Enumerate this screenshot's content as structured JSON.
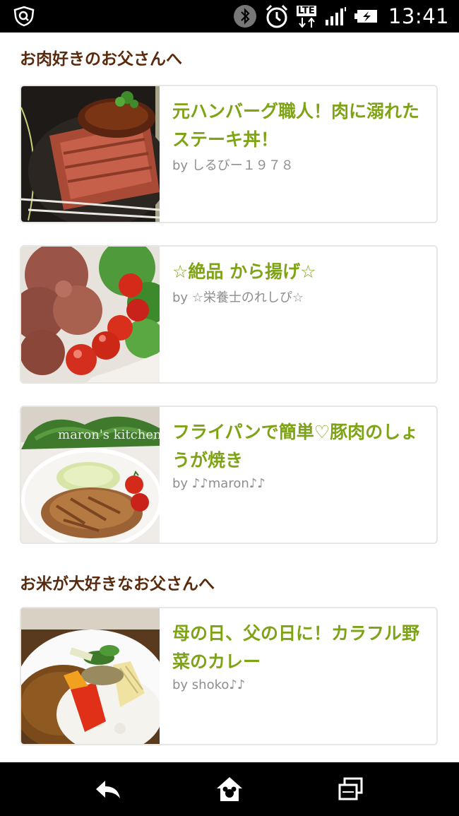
{
  "status_bar": {
    "time": "13:41",
    "network": "LTE",
    "icons": [
      "shield-search-icon",
      "bluetooth-icon",
      "alarm-icon",
      "lte-icon",
      "signal-icon",
      "battery-charging-icon"
    ]
  },
  "sections": [
    {
      "title": "お肉好きのお父さんへ",
      "recipes": [
        {
          "title": "元ハンバーグ職人！肉に溺れたステーキ丼！",
          "author": "by しるびー１９７８"
        },
        {
          "title": "☆絶品 から揚げ☆",
          "author": "by ☆栄養士のれしぴ☆"
        },
        {
          "title": "フライパンで簡単♡豚肉のしょうが焼き",
          "author": "by ♪♪maron♪♪",
          "image_text": "maron's kitchen"
        }
      ]
    },
    {
      "title": "お米が大好きなお父さんへ",
      "recipes": [
        {
          "title": "母の日、父の日に！カラフル野菜のカレー",
          "author": "by shoko♪♪"
        }
      ]
    }
  ],
  "nav_bar": {
    "icons": [
      "back-icon",
      "home-icon",
      "recent-apps-icon"
    ]
  },
  "colors": {
    "section_title": "#5a2a0c",
    "recipe_title": "#7ea315",
    "author": "#8e8e8e",
    "card_border": "#e6e6e2"
  }
}
